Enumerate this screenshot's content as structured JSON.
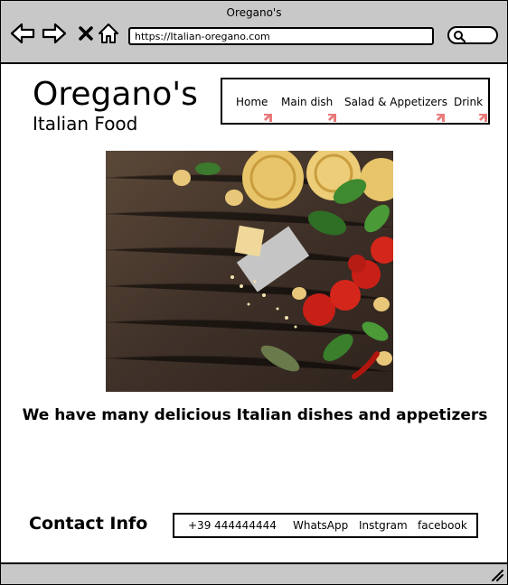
{
  "window": {
    "title": "Oregano's"
  },
  "browser": {
    "url": "https://Italian-oregano.com",
    "icons": [
      "back-arrow-icon",
      "forward-arrow-icon",
      "close-x-icon",
      "home-icon",
      "search-icon",
      "resize-grip-icon"
    ]
  },
  "header": {
    "title": "Oregano's",
    "subtitle": "Italian Food"
  },
  "nav": {
    "items": [
      {
        "label": "Home"
      },
      {
        "label": "Main dish"
      },
      {
        "label": "Salad & Appetizers"
      },
      {
        "label": "Drink"
      }
    ],
    "cursor_color": "#e87a7a"
  },
  "hero": {
    "background_color": "#4a3a30"
  },
  "main": {
    "tagline": "We have many delicious Italian dishes and appetizers"
  },
  "contact": {
    "title": "Contact Info",
    "items": [
      {
        "label": "+39  444444444"
      },
      {
        "label": "WhatsApp"
      },
      {
        "label": "Instgram"
      },
      {
        "label": "facebook"
      }
    ]
  }
}
